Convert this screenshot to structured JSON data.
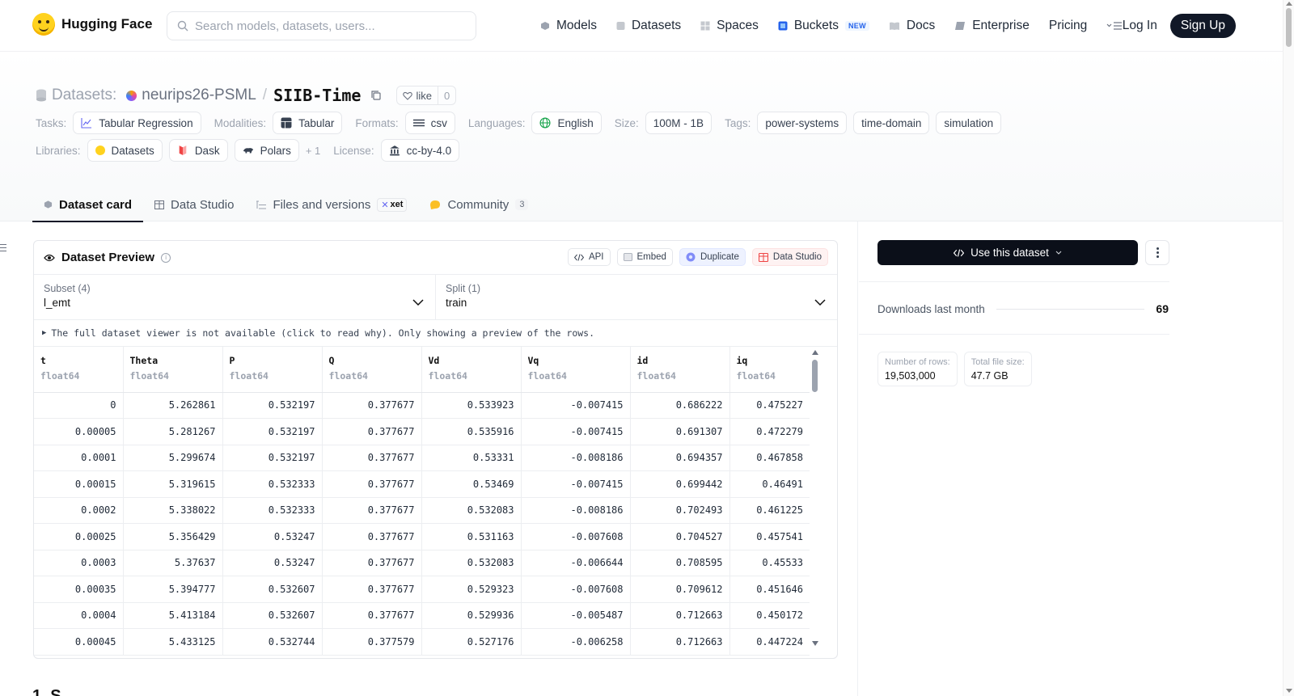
{
  "nav": {
    "brand": "Hugging Face",
    "search_placeholder": "Search models, datasets, users...",
    "links": [
      {
        "label": "Models",
        "icon": "models-icon",
        "color": "#6b7280"
      },
      {
        "label": "Datasets",
        "icon": "datasets-icon",
        "color": "#9ca3af"
      },
      {
        "label": "Spaces",
        "icon": "spaces-icon",
        "color": "#9ca3af"
      },
      {
        "label": "Buckets",
        "icon": "buckets-icon",
        "color": "#2563eb",
        "badge": "NEW"
      },
      {
        "label": "Docs",
        "icon": "docs-icon",
        "color": "#9ca3af"
      },
      {
        "label": "Enterprise",
        "icon": "enterprise-icon",
        "color": "#6b7280"
      },
      {
        "label": "Pricing"
      }
    ],
    "login": "Log In",
    "signup": "Sign Up"
  },
  "header": {
    "section_label": "Datasets:",
    "owner": "neurips26-PSML",
    "separator": "/",
    "name": "SIIB-Time",
    "like_label": "like",
    "like_count": "0",
    "tags_row1": {
      "tasks_label": "Tasks:",
      "tasks": "Tabular Regression",
      "modalities_label": "Modalities:",
      "modalities": "Tabular",
      "formats_label": "Formats:",
      "formats": "csv",
      "languages_label": "Languages:",
      "languages": "English",
      "size_label": "Size:",
      "size": "100M - 1B",
      "tags_label": "Tags:",
      "tags": [
        "power-systems",
        "time-domain",
        "simulation"
      ]
    },
    "tags_row2": {
      "libraries_label": "Libraries:",
      "libraries": [
        "Datasets",
        "Dask",
        "Polars"
      ],
      "more": "+ 1",
      "license_label": "License:",
      "license": "cc-by-4.0"
    }
  },
  "tabs": [
    {
      "label": "Dataset card",
      "active": true
    },
    {
      "label": "Data Studio"
    },
    {
      "label": "Files and versions",
      "badge": "xet"
    },
    {
      "label": "Community",
      "count": "3"
    }
  ],
  "preview": {
    "title": "Dataset Preview",
    "buttons": {
      "api": "API",
      "embed": "Embed",
      "duplicate": "Duplicate",
      "data_studio": "Data Studio"
    },
    "subset_label": "Subset (4)",
    "subset_value": "l_emt",
    "split_label": "Split (1)",
    "split_value": "train",
    "notice": "The full dataset viewer is not available (click to read why). Only showing a preview of the rows.",
    "columns": [
      {
        "name": "t",
        "type": "float64"
      },
      {
        "name": "Theta",
        "type": "float64"
      },
      {
        "name": "P",
        "type": "float64"
      },
      {
        "name": "Q",
        "type": "float64"
      },
      {
        "name": "Vd",
        "type": "float64"
      },
      {
        "name": "Vq",
        "type": "float64"
      },
      {
        "name": "id",
        "type": "float64"
      },
      {
        "name": "iq",
        "type": "float64"
      }
    ],
    "rows": [
      [
        "0",
        "5.262861",
        "0.532197",
        "0.377677",
        "0.533923",
        "-0.007415",
        "0.686222",
        "0.475227"
      ],
      [
        "0.00005",
        "5.281267",
        "0.532197",
        "0.377677",
        "0.535916",
        "-0.007415",
        "0.691307",
        "0.472279"
      ],
      [
        "0.0001",
        "5.299674",
        "0.532197",
        "0.377677",
        "0.53331",
        "-0.008186",
        "0.694357",
        "0.467858"
      ],
      [
        "0.00015",
        "5.319615",
        "0.532333",
        "0.377677",
        "0.53469",
        "-0.007415",
        "0.699442",
        "0.46491"
      ],
      [
        "0.0002",
        "5.338022",
        "0.532333",
        "0.377677",
        "0.532083",
        "-0.008186",
        "0.702493",
        "0.461225"
      ],
      [
        "0.00025",
        "5.356429",
        "0.53247",
        "0.377677",
        "0.531163",
        "-0.007608",
        "0.704527",
        "0.457541"
      ],
      [
        "0.0003",
        "5.37637",
        "0.53247",
        "0.377677",
        "0.532083",
        "-0.006644",
        "0.708595",
        "0.45533"
      ],
      [
        "0.00035",
        "5.394777",
        "0.532607",
        "0.377677",
        "0.529323",
        "-0.007608",
        "0.709612",
        "0.451646"
      ],
      [
        "0.0004",
        "5.413184",
        "0.532607",
        "0.377677",
        "0.529936",
        "-0.005487",
        "0.712663",
        "0.450172"
      ],
      [
        "0.00045",
        "5.433125",
        "0.532744",
        "0.377579",
        "0.527176",
        "-0.006258",
        "0.712663",
        "0.447224"
      ]
    ],
    "below_heading": "1. S"
  },
  "sidebar": {
    "use_button": "Use this dataset",
    "downloads_label": "Downloads last month",
    "downloads_value": "69",
    "rows_label": "Number of rows:",
    "rows_value": "19,503,000",
    "size_label": "Total file size:",
    "size_value": "47.7 GB"
  }
}
